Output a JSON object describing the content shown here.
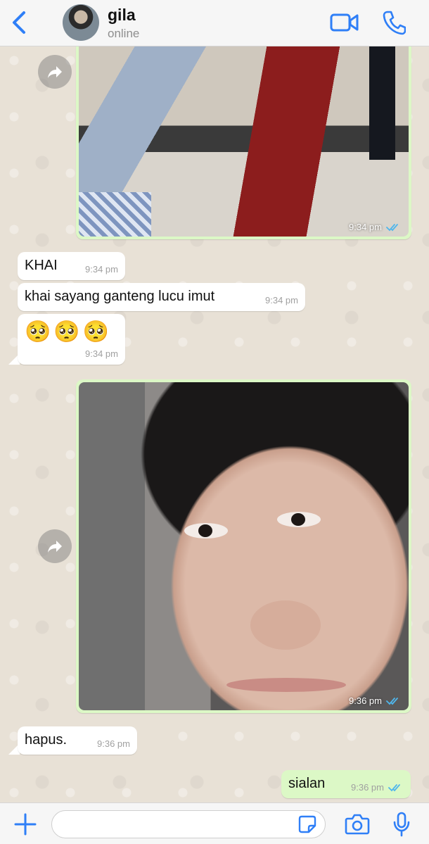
{
  "header": {
    "contact_name": "gila",
    "status": "online"
  },
  "messages": [
    {
      "type": "photo",
      "direction": "outgoing",
      "time": "9:34 pm",
      "read": true
    },
    {
      "type": "text",
      "direction": "incoming",
      "text": "KHAI",
      "time": "9:34 pm"
    },
    {
      "type": "text",
      "direction": "incoming",
      "text": "khai sayang ganteng lucu imut",
      "time": "9:34 pm"
    },
    {
      "type": "text",
      "direction": "incoming",
      "text": "🥺🥺🥺",
      "time": "9:34 pm"
    },
    {
      "type": "photo",
      "direction": "outgoing",
      "time": "9:36 pm",
      "read": true
    },
    {
      "type": "text",
      "direction": "incoming",
      "text": "hapus.",
      "time": "9:36 pm"
    },
    {
      "type": "text",
      "direction": "outgoing",
      "text": "sialan",
      "time": "9:36 pm",
      "read": true
    }
  ],
  "composer": {
    "placeholder": ""
  },
  "colors": {
    "accent": "#2f7ff7",
    "outgoing_bubble": "#dcf8c6",
    "incoming_bubble": "#ffffff",
    "read_ticks": "#4fb6ec"
  }
}
